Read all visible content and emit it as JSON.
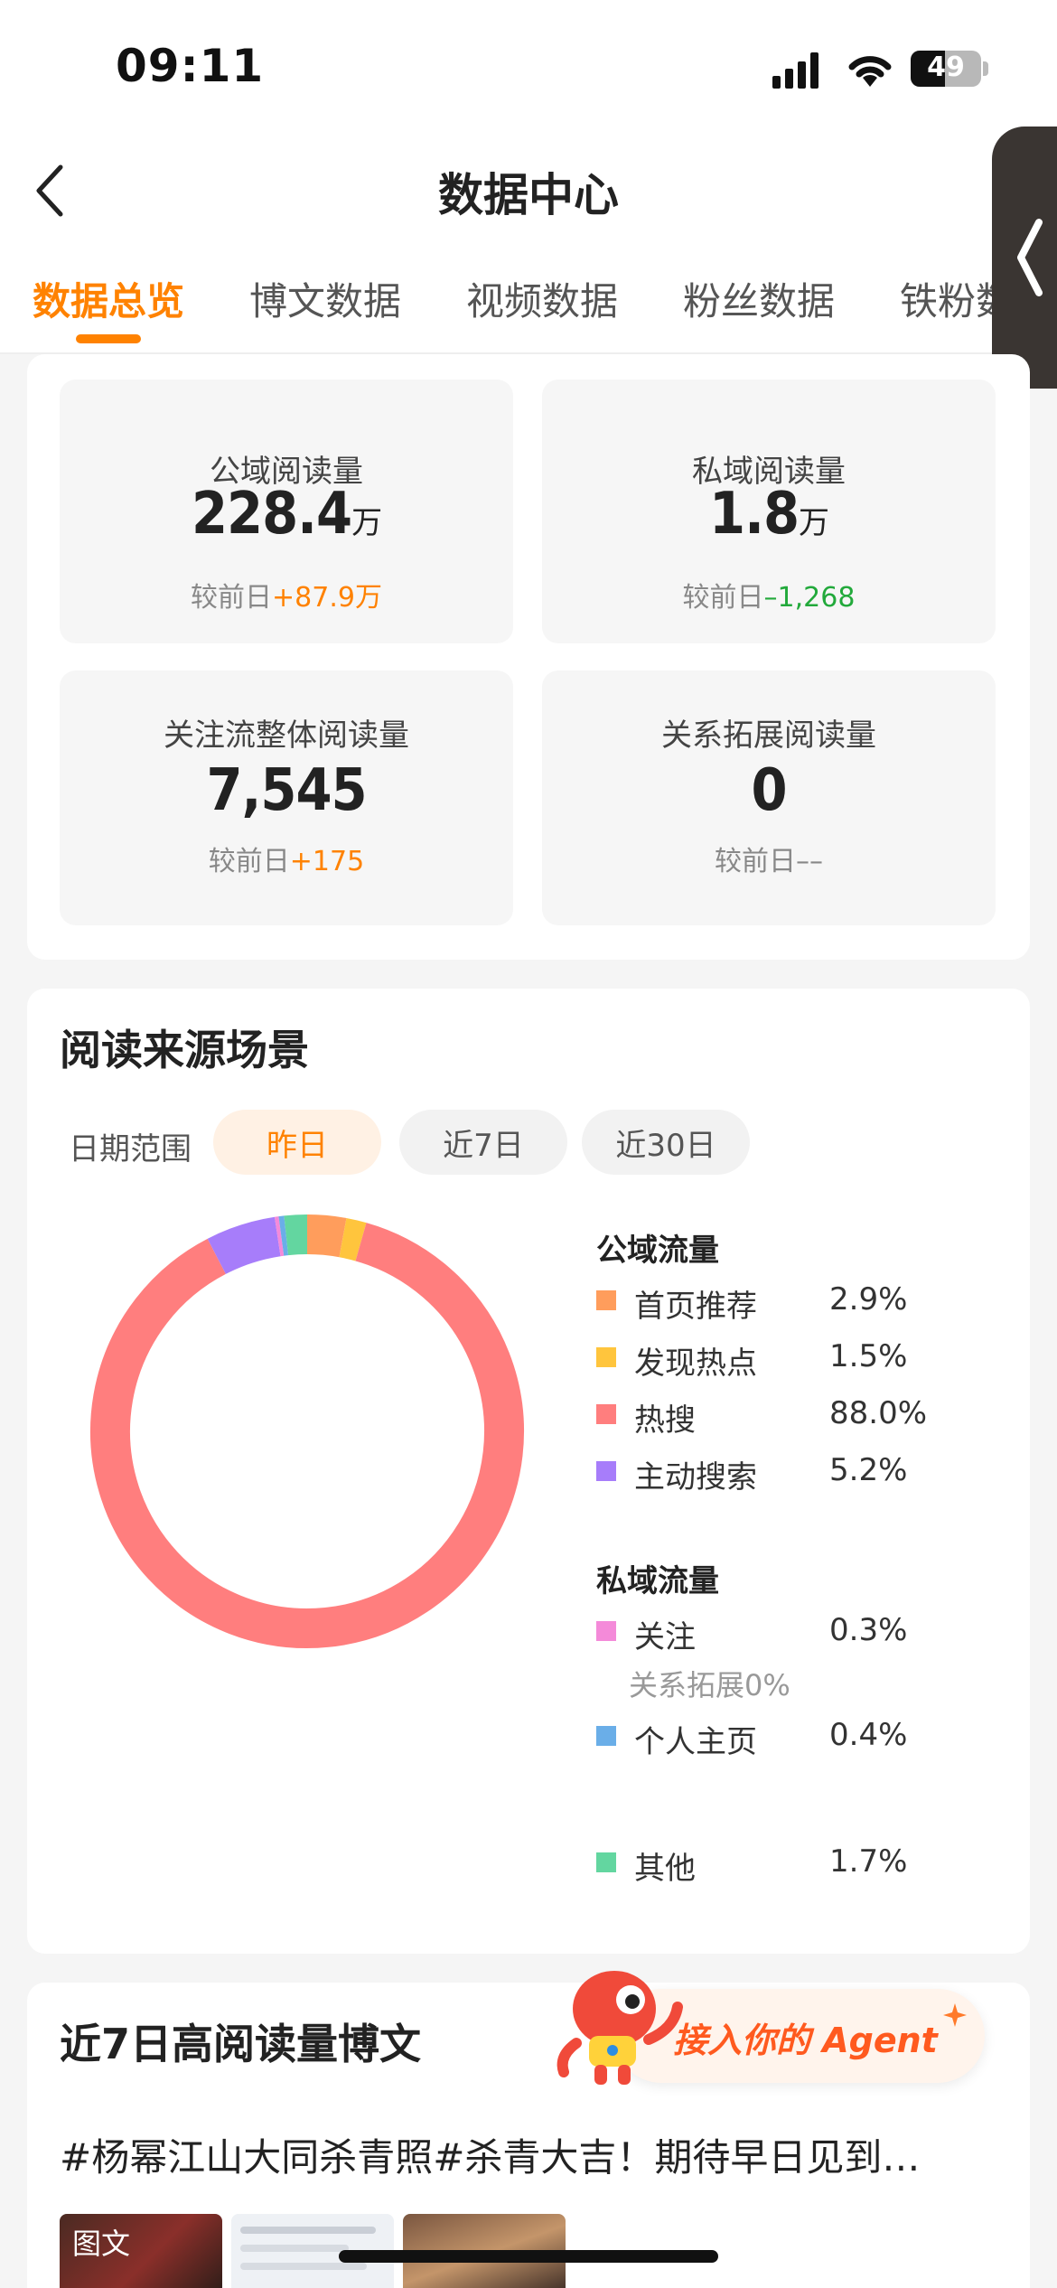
{
  "status_bar": {
    "time": "09:11",
    "battery": "49",
    "battery_level": 0.49
  },
  "nav": {
    "title": "数据中心"
  },
  "tabs": [
    {
      "label": "数据总览",
      "active": true
    },
    {
      "label": "博文数据",
      "active": false
    },
    {
      "label": "视频数据",
      "active": false
    },
    {
      "label": "粉丝数据",
      "active": false
    },
    {
      "label": "铁粉数",
      "active": false
    }
  ],
  "stats": [
    {
      "label": "公域阅读量",
      "value": "228.4",
      "unit": "万",
      "compare_prefix": "较前日",
      "compare_value": "+87.9万",
      "trend": "up"
    },
    {
      "label": "私域阅读量",
      "value": "1.8",
      "unit": "万",
      "compare_prefix": "较前日",
      "compare_value": "–1,268",
      "trend": "down"
    },
    {
      "label": "关注流整体阅读量",
      "value": "7,545",
      "unit": "",
      "compare_prefix": "较前日",
      "compare_value": "+175",
      "trend": "up"
    },
    {
      "label": "关系拓展阅读量",
      "value": "0",
      "unit": "",
      "compare_prefix": "较前日",
      "compare_value": "––",
      "trend": "none"
    }
  ],
  "source": {
    "title": "阅读来源场景",
    "range_label": "日期范围",
    "ranges": [
      {
        "label": "昨日",
        "active": true
      },
      {
        "label": "近7日",
        "active": false
      },
      {
        "label": "近30日",
        "active": false
      }
    ],
    "public_title": "公域流量",
    "private_title": "私域流量",
    "relation_note": "关系拓展0%"
  },
  "chart_data": {
    "type": "pie",
    "donut": true,
    "start_segment": "首页推荐",
    "segments": [
      {
        "name": "首页推荐",
        "value": 2.9,
        "label": "2.9%",
        "color": "#ff9d5c",
        "group": "公域流量"
      },
      {
        "name": "发现热点",
        "value": 1.5,
        "label": "1.5%",
        "color": "#ffc53d",
        "group": "公域流量"
      },
      {
        "name": "热搜",
        "value": 88.0,
        "label": "88.0%",
        "color": "#ff7e7e",
        "group": "公域流量"
      },
      {
        "name": "主动搜索",
        "value": 5.2,
        "label": "5.2%",
        "color": "#a77dfa",
        "group": "公域流量"
      },
      {
        "name": "关注",
        "value": 0.3,
        "label": "0.3%",
        "color": "#f48ad9",
        "group": "私域流量"
      },
      {
        "name": "个人主页",
        "value": 0.4,
        "label": "0.4%",
        "color": "#6aaee8",
        "group": "私域流量"
      },
      {
        "name": "其他",
        "value": 1.7,
        "label": "1.7%",
        "color": "#63d6a0",
        "group": "其他"
      }
    ]
  },
  "top_posts": {
    "title": "近7日高阅读量博文",
    "post_title": "#杨幂江山大同杀青照#杀青大吉！期待早日见到…",
    "thumb_tag": "图文"
  },
  "agent_banner": {
    "label": "接入你的 Agent"
  },
  "colors": {
    "accent": "#ff8200",
    "up": "#ff8200",
    "down": "#22a93b"
  }
}
